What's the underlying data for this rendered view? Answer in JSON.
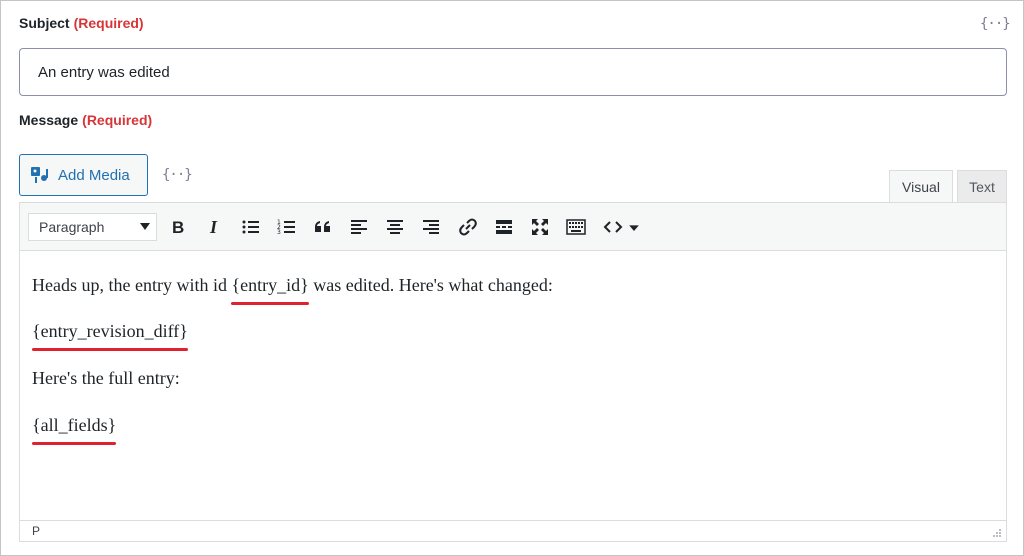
{
  "subject": {
    "label": "Subject",
    "required": "(Required)",
    "value": "An entry was edited",
    "merge_tag_icon": "merge-tags-icon"
  },
  "message": {
    "label": "Message",
    "required": "(Required)",
    "add_media_label": "Add Media",
    "merge_tag_icon": "merge-tags-icon"
  },
  "editor": {
    "tabs": [
      {
        "label": "Visual",
        "active": true
      },
      {
        "label": "Text",
        "active": false
      }
    ],
    "format_select": "Paragraph",
    "toolbar_icons": [
      "bold-icon",
      "italic-icon",
      "bullet-list-icon",
      "numbered-list-icon",
      "blockquote-icon",
      "align-left-icon",
      "align-center-icon",
      "align-right-icon",
      "link-icon",
      "read-more-icon",
      "fullscreen-icon",
      "toolbar-toggle-icon",
      "code-icon",
      "dropdown-icon"
    ],
    "content": {
      "line1_before": "Heads up, the entry with id ",
      "line1_tag": "{entry_id}",
      "line1_after": " was edited. Here's what changed:",
      "line2_tag": "{entry_revision_diff}",
      "line3": "Here's the full entry:",
      "line4_tag": "{all_fields}"
    },
    "status_path": "P"
  },
  "colors": {
    "required": "#d63638",
    "highlight_underline": "#e0212f",
    "accent": "#2271b1"
  }
}
